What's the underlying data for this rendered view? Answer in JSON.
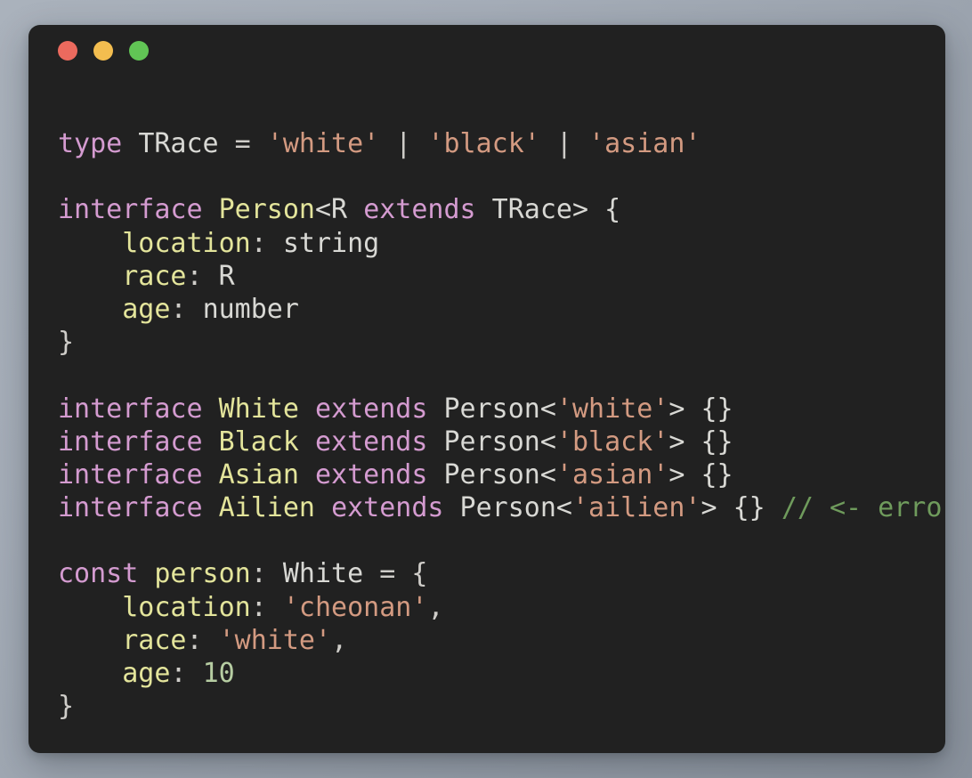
{
  "window": {
    "background_color": "#212121",
    "traffic_lights": [
      {
        "name": "close",
        "color": "#ec6a5e"
      },
      {
        "name": "minimize",
        "color": "#f3bd4f"
      },
      {
        "name": "maximize",
        "color": "#61c555"
      }
    ]
  },
  "theme": {
    "page_background": "#a3abb6",
    "keyword": "#d49bd0",
    "type": "#d8d8d4",
    "identifier": "#e3e49b",
    "string": "#d39a81",
    "number": "#b6cda2",
    "comment": "#6f9b5c",
    "punctuation": "#cfcdc9",
    "default_text": "#ccc9c4"
  },
  "code": {
    "language": "typescript",
    "font_size_px": 30,
    "line_height_px": 37,
    "plain_text": "type TRace = 'white' | 'black' | 'asian'\n\ninterface Person<R extends TRace> {\n    location: string\n    race: R\n    age: number\n}\n\ninterface White extends Person<'white'> {}\ninterface Black extends Person<'black'> {}\ninterface Asian extends Person<'asian'> {}\ninterface Ailien extends Person<'ailien'> {} // <- error\n\nconst person: White = {\n    location: 'cheonan',\n    race: 'white',\n    age: 10\n}",
    "lines": [
      {
        "n": 1,
        "tokens": [
          {
            "t": "type",
            "c": "keyword"
          },
          {
            "t": " ",
            "c": "plain"
          },
          {
            "t": "TRace",
            "c": "type"
          },
          {
            "t": " = ",
            "c": "punctuation"
          },
          {
            "t": "'white'",
            "c": "string"
          },
          {
            "t": " | ",
            "c": "punctuation"
          },
          {
            "t": "'black'",
            "c": "string"
          },
          {
            "t": " | ",
            "c": "punctuation"
          },
          {
            "t": "'asian'",
            "c": "string"
          }
        ]
      },
      {
        "n": 2,
        "tokens": []
      },
      {
        "n": 3,
        "tokens": [
          {
            "t": "interface",
            "c": "keyword"
          },
          {
            "t": " ",
            "c": "plain"
          },
          {
            "t": "Person",
            "c": "identifier"
          },
          {
            "t": "<R ",
            "c": "type"
          },
          {
            "t": "extends",
            "c": "keyword"
          },
          {
            "t": " TRace> {",
            "c": "type"
          }
        ]
      },
      {
        "n": 4,
        "tokens": [
          {
            "t": "    ",
            "c": "plain"
          },
          {
            "t": "location",
            "c": "identifier"
          },
          {
            "t": ": ",
            "c": "punctuation"
          },
          {
            "t": "string",
            "c": "type"
          }
        ]
      },
      {
        "n": 5,
        "tokens": [
          {
            "t": "    ",
            "c": "plain"
          },
          {
            "t": "race",
            "c": "identifier"
          },
          {
            "t": ": ",
            "c": "punctuation"
          },
          {
            "t": "R",
            "c": "type"
          }
        ]
      },
      {
        "n": 6,
        "tokens": [
          {
            "t": "    ",
            "c": "plain"
          },
          {
            "t": "age",
            "c": "identifier"
          },
          {
            "t": ": ",
            "c": "punctuation"
          },
          {
            "t": "number",
            "c": "type"
          }
        ]
      },
      {
        "n": 7,
        "tokens": [
          {
            "t": "}",
            "c": "punctuation"
          }
        ]
      },
      {
        "n": 8,
        "tokens": []
      },
      {
        "n": 9,
        "tokens": [
          {
            "t": "interface",
            "c": "keyword"
          },
          {
            "t": " ",
            "c": "plain"
          },
          {
            "t": "White",
            "c": "identifier"
          },
          {
            "t": " ",
            "c": "plain"
          },
          {
            "t": "extends",
            "c": "keyword"
          },
          {
            "t": " Person<",
            "c": "type"
          },
          {
            "t": "'white'",
            "c": "string"
          },
          {
            "t": "> {}",
            "c": "type"
          }
        ]
      },
      {
        "n": 10,
        "tokens": [
          {
            "t": "interface",
            "c": "keyword"
          },
          {
            "t": " ",
            "c": "plain"
          },
          {
            "t": "Black",
            "c": "identifier"
          },
          {
            "t": " ",
            "c": "plain"
          },
          {
            "t": "extends",
            "c": "keyword"
          },
          {
            "t": " Person<",
            "c": "type"
          },
          {
            "t": "'black'",
            "c": "string"
          },
          {
            "t": "> {}",
            "c": "type"
          }
        ]
      },
      {
        "n": 11,
        "tokens": [
          {
            "t": "interface",
            "c": "keyword"
          },
          {
            "t": " ",
            "c": "plain"
          },
          {
            "t": "Asian",
            "c": "identifier"
          },
          {
            "t": " ",
            "c": "plain"
          },
          {
            "t": "extends",
            "c": "keyword"
          },
          {
            "t": " Person<",
            "c": "type"
          },
          {
            "t": "'asian'",
            "c": "string"
          },
          {
            "t": "> {}",
            "c": "type"
          }
        ]
      },
      {
        "n": 12,
        "tokens": [
          {
            "t": "interface",
            "c": "keyword"
          },
          {
            "t": " ",
            "c": "plain"
          },
          {
            "t": "Ailien",
            "c": "identifier"
          },
          {
            "t": " ",
            "c": "plain"
          },
          {
            "t": "extends",
            "c": "keyword"
          },
          {
            "t": " Person<",
            "c": "type"
          },
          {
            "t": "'ailien'",
            "c": "string"
          },
          {
            "t": "> {} ",
            "c": "type"
          },
          {
            "t": "// <- error",
            "c": "comment"
          }
        ]
      },
      {
        "n": 13,
        "tokens": []
      },
      {
        "n": 14,
        "tokens": [
          {
            "t": "const",
            "c": "keyword"
          },
          {
            "t": " ",
            "c": "plain"
          },
          {
            "t": "person",
            "c": "identifier"
          },
          {
            "t": ": ",
            "c": "punctuation"
          },
          {
            "t": "White",
            "c": "type"
          },
          {
            "t": " = {",
            "c": "punctuation"
          }
        ]
      },
      {
        "n": 15,
        "tokens": [
          {
            "t": "    ",
            "c": "plain"
          },
          {
            "t": "location",
            "c": "identifier"
          },
          {
            "t": ": ",
            "c": "punctuation"
          },
          {
            "t": "'cheonan'",
            "c": "string"
          },
          {
            "t": ",",
            "c": "punctuation"
          }
        ]
      },
      {
        "n": 16,
        "tokens": [
          {
            "t": "    ",
            "c": "plain"
          },
          {
            "t": "race",
            "c": "identifier"
          },
          {
            "t": ": ",
            "c": "punctuation"
          },
          {
            "t": "'white'",
            "c": "string"
          },
          {
            "t": ",",
            "c": "punctuation"
          }
        ]
      },
      {
        "n": 17,
        "tokens": [
          {
            "t": "    ",
            "c": "plain"
          },
          {
            "t": "age",
            "c": "identifier"
          },
          {
            "t": ": ",
            "c": "punctuation"
          },
          {
            "t": "10",
            "c": "number"
          }
        ]
      },
      {
        "n": 18,
        "tokens": [
          {
            "t": "}",
            "c": "punctuation"
          }
        ]
      }
    ]
  }
}
